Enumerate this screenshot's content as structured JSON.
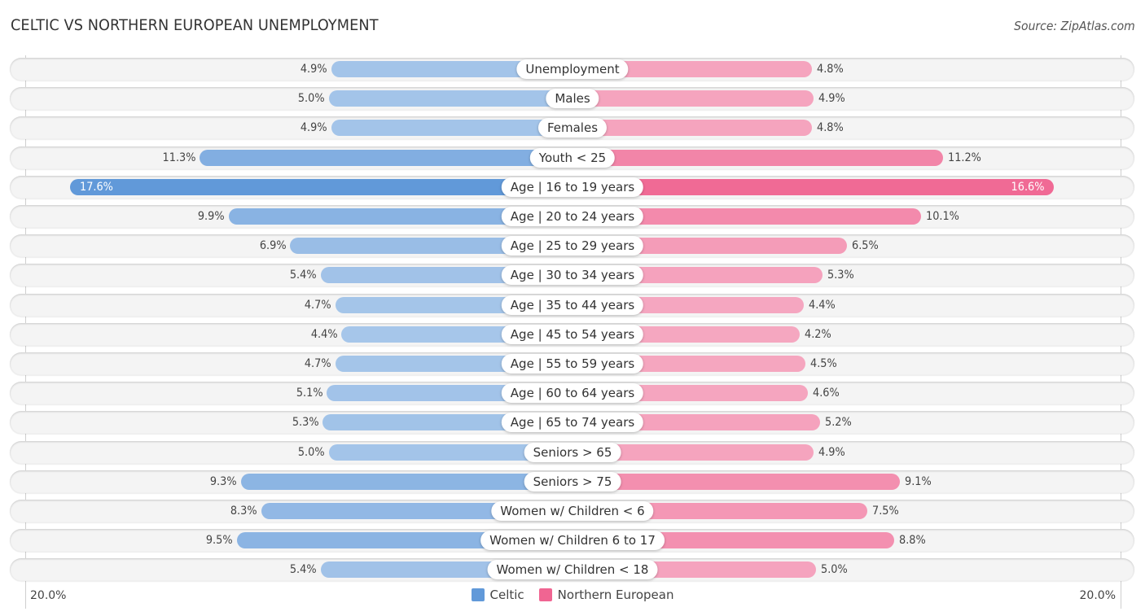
{
  "title": "CELTIC VS NORTHERN EUROPEAN UNEMPLOYMENT",
  "source": "Source: ZipAtlas.com",
  "chart_data": {
    "type": "bar",
    "orientation": "horizontal-diverging",
    "title": "CELTIC VS NORTHERN EUROPEAN UNEMPLOYMENT",
    "source": "Source: ZipAtlas.com",
    "unit": "%",
    "axis_min_label": "20.0%",
    "axis_max_label": "20.0%",
    "xlim": [
      0,
      20
    ],
    "legend_position": "bottom-center",
    "grid": false,
    "categories": [
      "Unemployment",
      "Males",
      "Females",
      "Youth < 25",
      "Age | 16 to 19 years",
      "Age | 20 to 24 years",
      "Age | 25 to 29 years",
      "Age | 30 to 34 years",
      "Age | 35 to 44 years",
      "Age | 45 to 54 years",
      "Age | 55 to 59 years",
      "Age | 60 to 64 years",
      "Age | 65 to 74 years",
      "Seniors > 65",
      "Seniors > 75",
      "Women w/ Children < 6",
      "Women w/ Children 6 to 17",
      "Women w/ Children < 18"
    ],
    "series": [
      {
        "name": "Celtic",
        "side": "left",
        "color": "#6199d9",
        "color_light": "#a8c7ea",
        "values": [
          4.9,
          5.0,
          4.9,
          11.3,
          17.6,
          9.9,
          6.9,
          5.4,
          4.7,
          4.4,
          4.7,
          5.1,
          5.3,
          5.0,
          9.3,
          8.3,
          9.5,
          5.4
        ]
      },
      {
        "name": "Northern European",
        "side": "right",
        "color": "#f06592",
        "color_light": "#f5a8c1",
        "values": [
          4.8,
          4.9,
          4.8,
          11.2,
          16.6,
          10.1,
          6.5,
          5.3,
          4.4,
          4.2,
          4.5,
          4.6,
          5.2,
          4.9,
          9.1,
          7.5,
          8.8,
          5.0
        ]
      }
    ]
  },
  "legend": [
    {
      "label": "Celtic",
      "color": "#6199d9"
    },
    {
      "label": "Northern European",
      "color": "#f06592"
    }
  ]
}
